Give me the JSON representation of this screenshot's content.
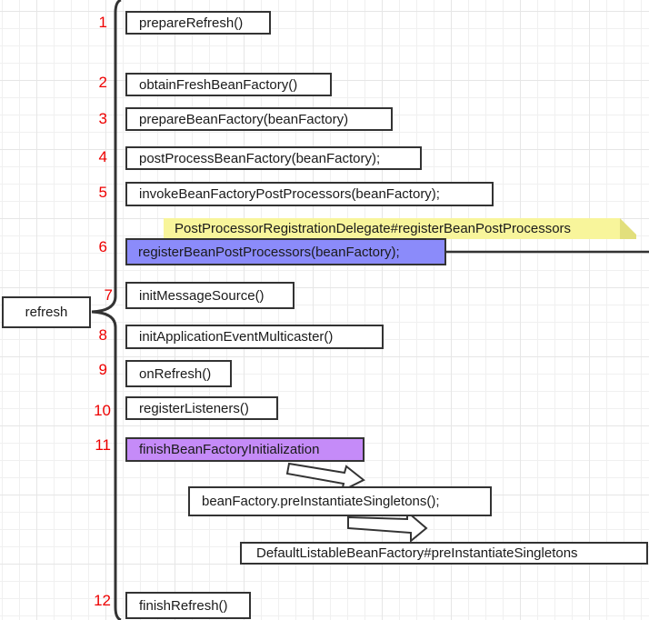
{
  "root": {
    "label": "refresh"
  },
  "colors": {
    "step_number": "#ee0000",
    "highlight_blue": "#8b8bfa",
    "highlight_purple": "#c58bf8",
    "note_yellow": "#f8f59b",
    "border": "#333333"
  },
  "steps": [
    {
      "number": "1",
      "label": "prepareRefresh()"
    },
    {
      "number": "2",
      "label": "obtainFreshBeanFactory()"
    },
    {
      "number": "3",
      "label": "prepareBeanFactory(beanFactory)"
    },
    {
      "number": "4",
      "label": "postProcessBeanFactory(beanFactory);"
    },
    {
      "number": "5",
      "label": "invokeBeanFactoryPostProcessors(beanFactory);"
    },
    {
      "number": "6",
      "label": "registerBeanPostProcessors(beanFactory);",
      "note": "PostProcessorRegistrationDelegate#registerBeanPostProcessors"
    },
    {
      "number": "7",
      "label": "initMessageSource()"
    },
    {
      "number": "8",
      "label": "initApplicationEventMulticaster()"
    },
    {
      "number": "9",
      "label": "onRefresh()"
    },
    {
      "number": "10",
      "label": "registerListeners()"
    },
    {
      "number": "11",
      "label": "finishBeanFactoryInitialization",
      "children": [
        {
          "label": "beanFactory.preInstantiateSingletons();"
        },
        {
          "label": "DefaultListableBeanFactory#preInstantiateSingletons"
        }
      ]
    },
    {
      "number": "12",
      "label": "finishRefresh()"
    }
  ]
}
